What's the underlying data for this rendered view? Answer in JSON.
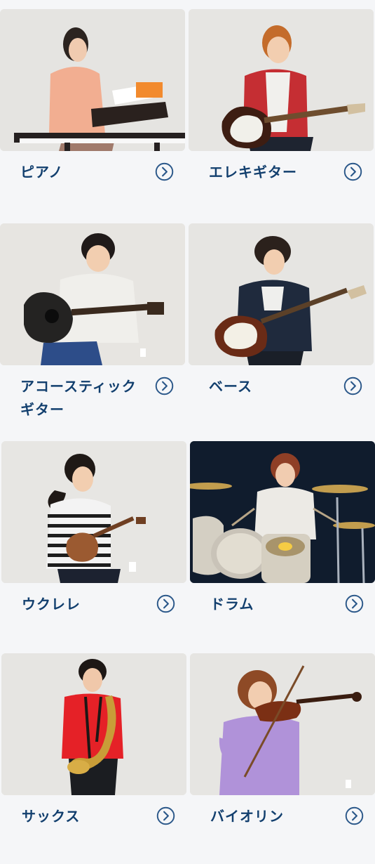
{
  "lessons": [
    {
      "label": "ピアノ",
      "photo_icon": "piano-photo",
      "arrow_icon": "circle-chevron-right-icon"
    },
    {
      "label": "エレキギター",
      "photo_icon": "electric-guitar-photo",
      "arrow_icon": "circle-chevron-right-icon"
    },
    {
      "label": "アコースティックギター",
      "photo_icon": "acoustic-guitar-photo",
      "arrow_icon": "circle-chevron-right-icon"
    },
    {
      "label": "ベース",
      "photo_icon": "bass-photo",
      "arrow_icon": "circle-chevron-right-icon"
    },
    {
      "label": "ウクレレ",
      "photo_icon": "ukulele-photo",
      "arrow_icon": "circle-chevron-right-icon"
    },
    {
      "label": "ドラム",
      "photo_icon": "drums-photo",
      "arrow_icon": "circle-chevron-right-icon"
    },
    {
      "label": "サックス",
      "photo_icon": "saxophone-photo",
      "arrow_icon": "circle-chevron-right-icon"
    },
    {
      "label": "バイオリン",
      "photo_icon": "violin-photo",
      "arrow_icon": "circle-chevron-right-icon"
    }
  ],
  "colors": {
    "label_text": "#123f6e",
    "arrow_icon": "#2a5789",
    "page_background": "#f5f6f8",
    "photo_background": "#e6e5e2",
    "drum_photo_background": "#0d1724"
  }
}
